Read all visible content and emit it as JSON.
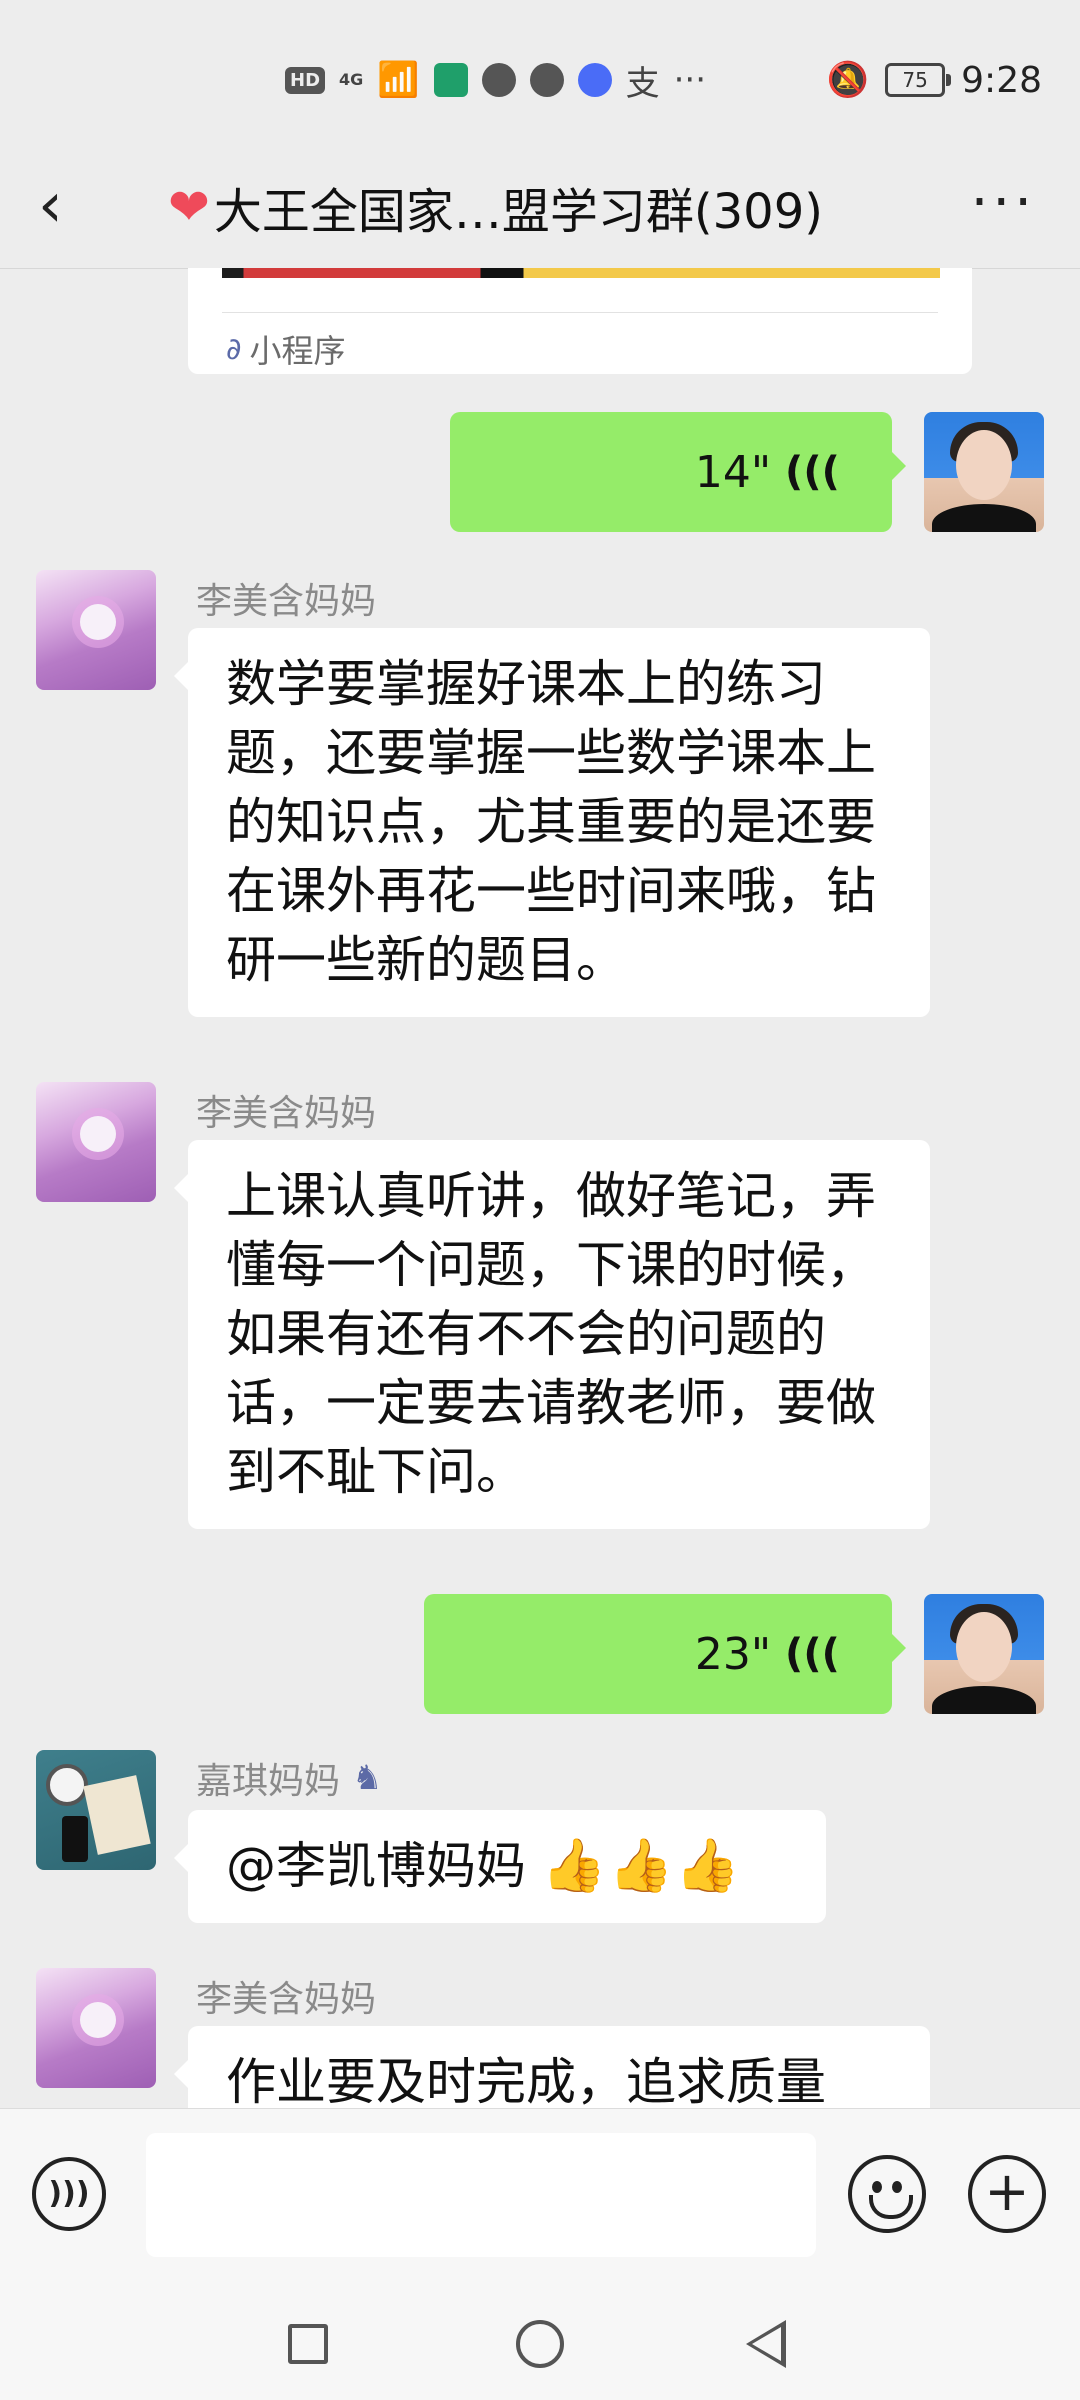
{
  "status_bar": {
    "hd": "HD",
    "network": "4G",
    "battery": "75",
    "time": "9:28",
    "extra": "支",
    "more": "···",
    "icons": [
      "signal-icon",
      "app-icon",
      "chat-icon",
      "browser-icon",
      "music-icon",
      "mute-icon"
    ]
  },
  "header": {
    "title": "大王全国家…盟学习群(309)",
    "back_icon": "‹",
    "more_icon": "···",
    "heart_icon": "❤"
  },
  "mini_program": {
    "label": "小程序",
    "icon": "link-icon"
  },
  "messages": [
    {
      "type": "voice",
      "direction": "out",
      "duration": "14\""
    },
    {
      "type": "text",
      "direction": "in",
      "sender": "李美含妈妈",
      "text": "数学要掌握好课本上的练习题，还要掌握一些数学课本上的知识点，尤其重要的是还要在课外再花一些时间来哦，钻研一些新的题目。"
    },
    {
      "type": "text",
      "direction": "in",
      "sender": "李美含妈妈",
      "text": "上课认真听讲，做好笔记，弄懂每一个问题，下课的时候，如果有还有不不会的问题的话，一定要去请教老师，要做到不耻下问。"
    },
    {
      "type": "voice",
      "direction": "out",
      "duration": "23\""
    },
    {
      "type": "text",
      "direction": "in",
      "sender": "嘉琪妈妈",
      "text": "@李凯博妈妈",
      "emoji": "👍👍👍",
      "sender_badge": "admin-icon"
    },
    {
      "type": "text",
      "direction": "in",
      "sender": "李美含妈妈",
      "text": "作业要及时完成，追求质量"
    }
  ],
  "input_bar": {
    "placeholder": ""
  },
  "colors": {
    "outgoing_bubble": "#95ec69",
    "background": "#ededed",
    "heart": "#ef4a5a"
  }
}
